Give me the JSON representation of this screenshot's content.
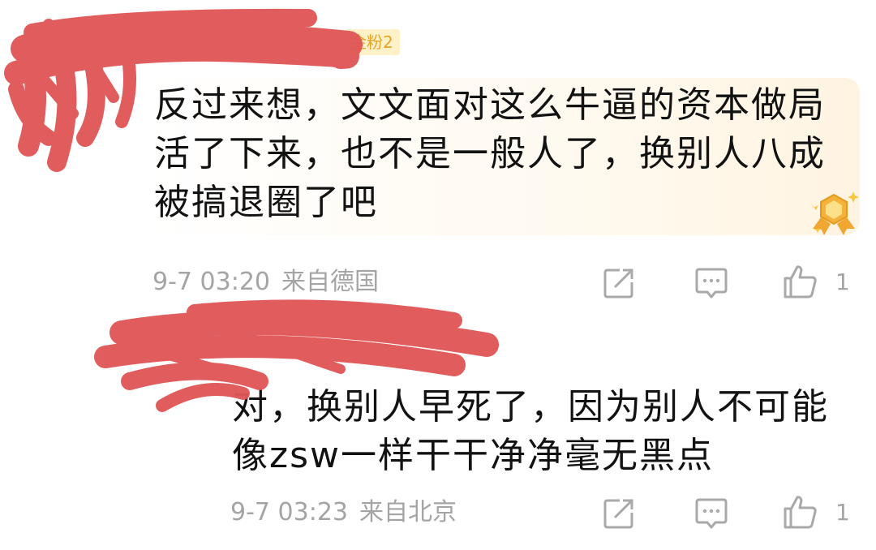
{
  "comments": [
    {
      "badge": "金粉2",
      "text": "反过来想，文文面对这么牛逼的资本做局活了下来，也不是一般人了，换别人八成被搞退圈了吧",
      "time": "9-7 03:20",
      "location": "来自德国",
      "likes": "1",
      "has_medal": true
    },
    {
      "text": "对，换别人早死了，因为别人不可能像zsw一样干干净净毫无黑点",
      "time": "9-7 03:23",
      "location": "来自北京",
      "likes": "1"
    }
  ],
  "icons": {
    "share": "share-icon",
    "reply": "comment-icon",
    "like": "thumbs-up-icon",
    "medal": "gold-medal-icon"
  },
  "colors": {
    "text": "#121212",
    "meta": "#a4a4a4",
    "badge": "#e3a527",
    "redaction": "#e05757"
  }
}
